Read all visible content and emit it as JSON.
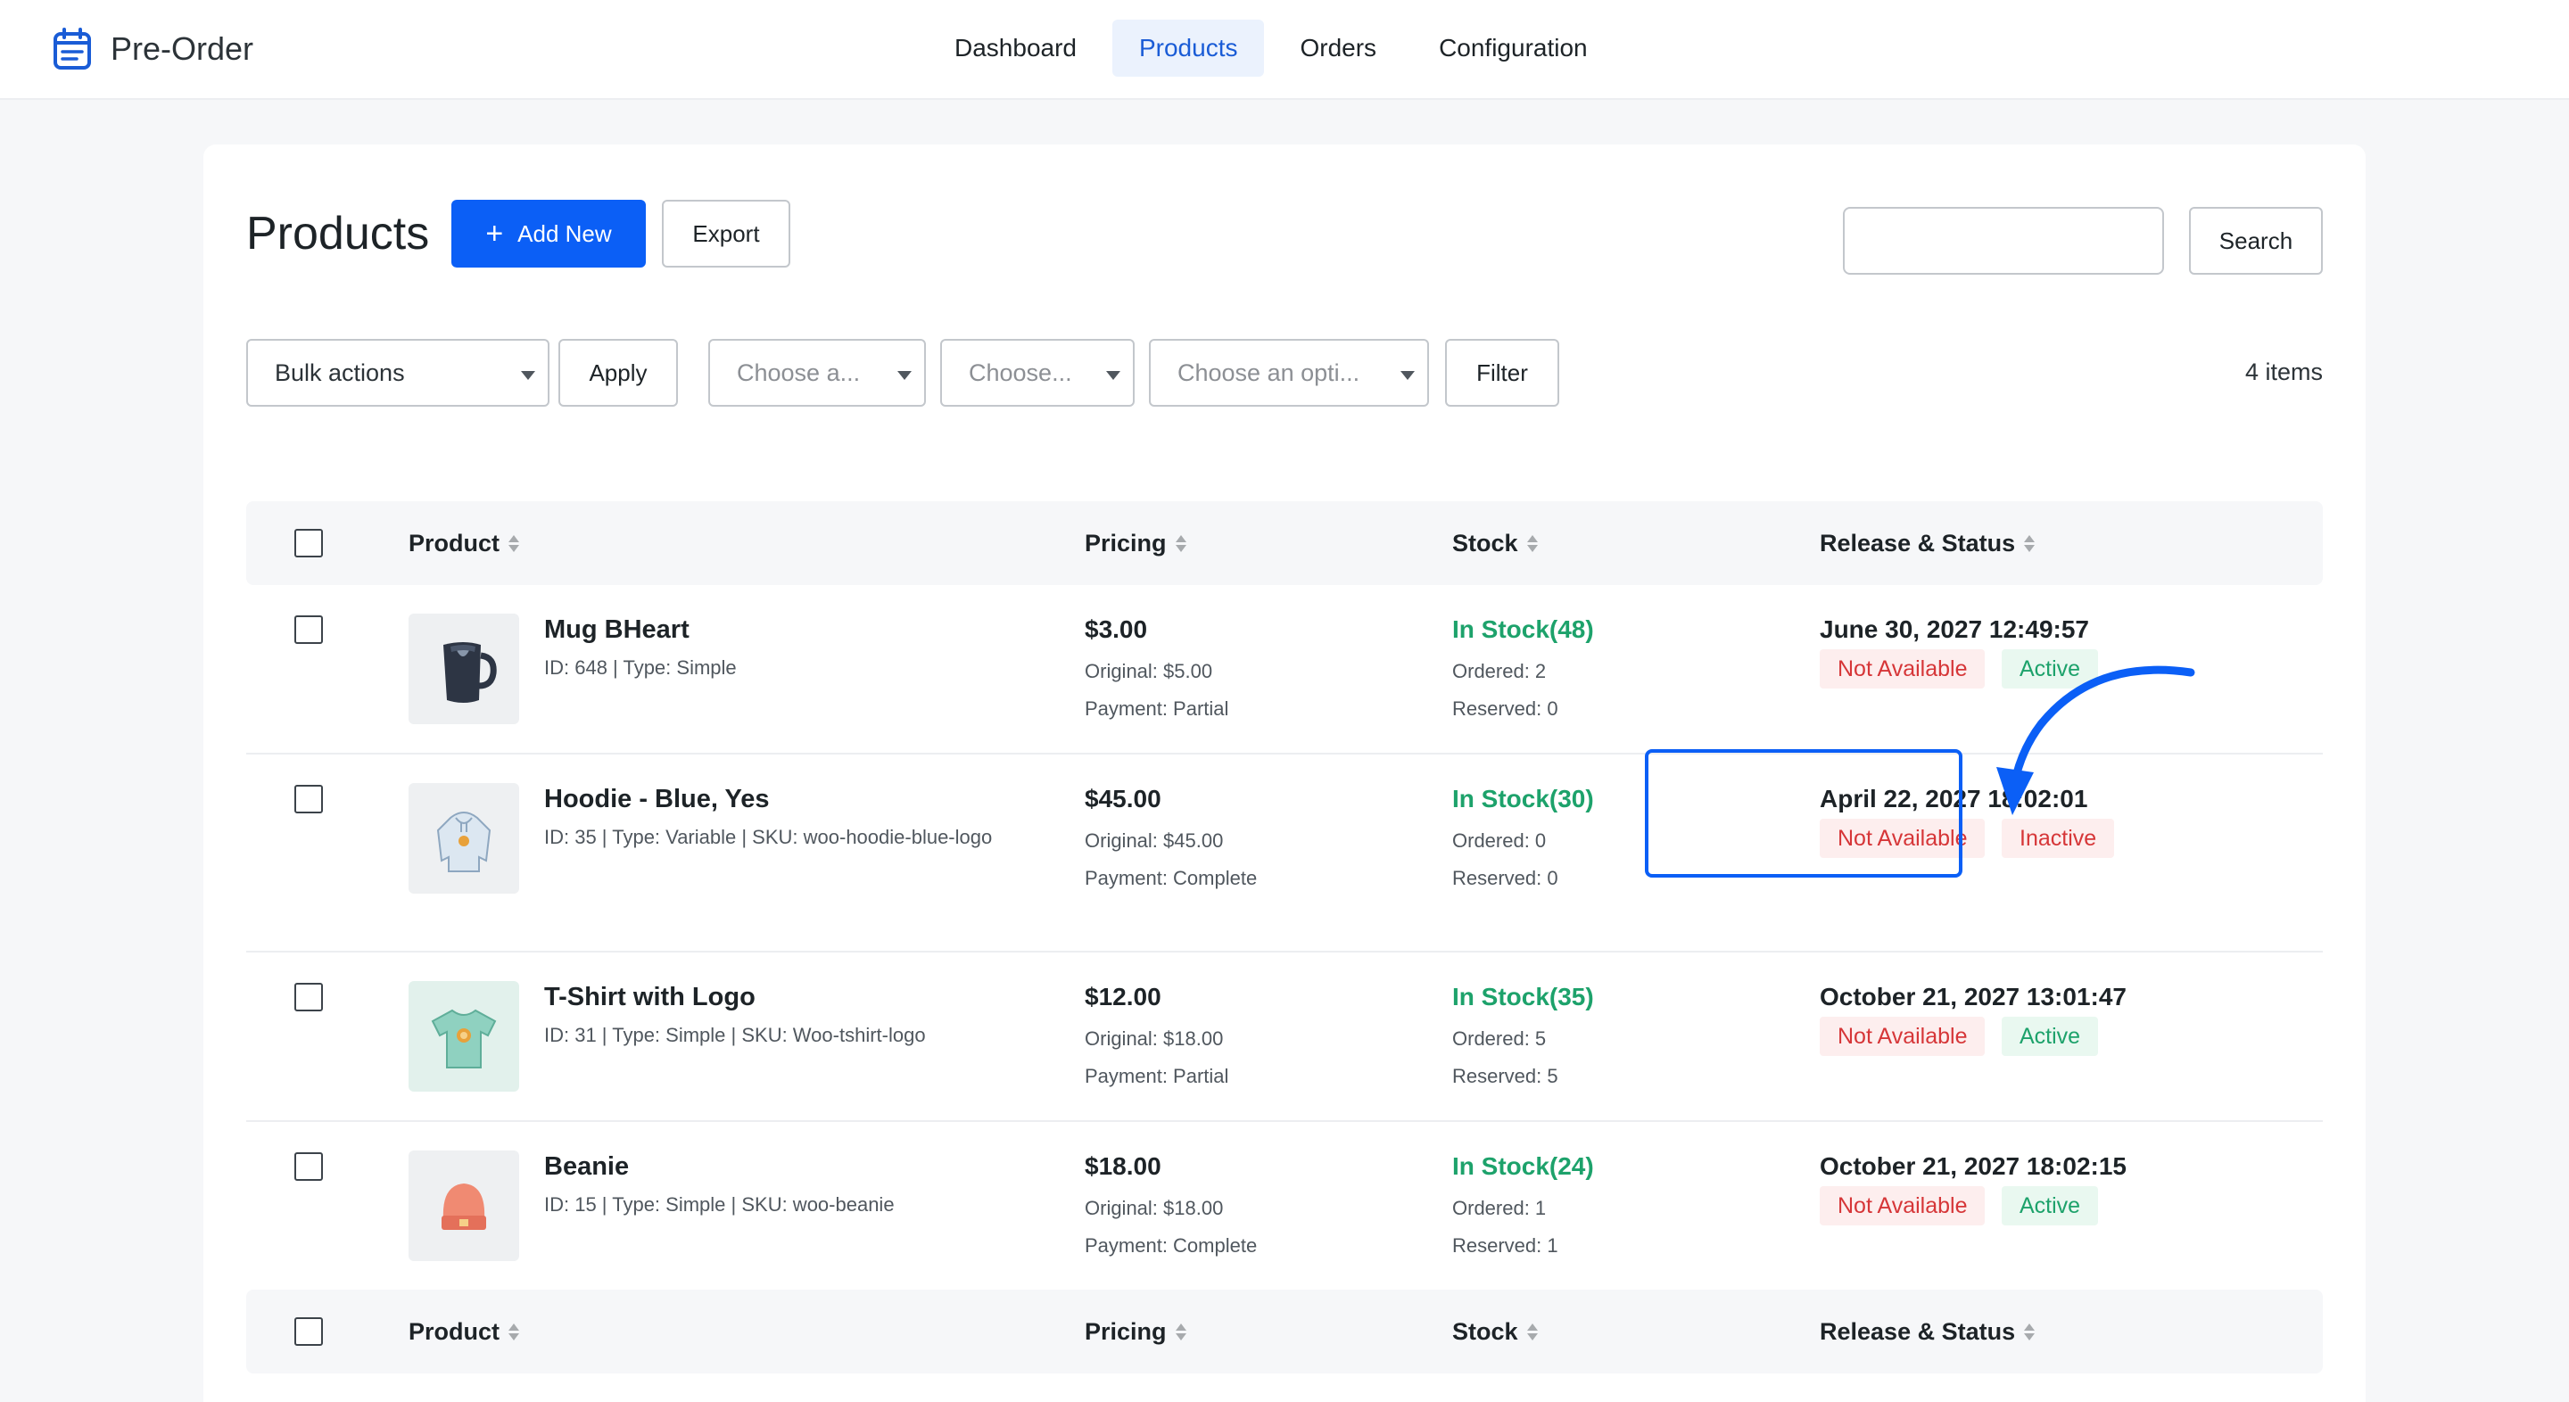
{
  "app": {
    "name": "Pre-Order",
    "icon": "calendar-icon"
  },
  "nav": [
    {
      "label": "Dashboard",
      "active": false
    },
    {
      "label": "Products",
      "active": true
    },
    {
      "label": "Orders",
      "active": false
    },
    {
      "label": "Configuration",
      "active": false
    }
  ],
  "page": {
    "title": "Products",
    "add_new_label": "Add New",
    "export_label": "Export",
    "search_value": "",
    "search_placeholder": "",
    "search_label": "Search"
  },
  "filters": {
    "bulk_actions": "Bulk actions",
    "apply_label": "Apply",
    "select1": "Choose a...",
    "select2": "Choose...",
    "select3": "Choose an opti...",
    "filter_label": "Filter",
    "items_count": "4 items"
  },
  "columns": {
    "product": "Product",
    "pricing": "Pricing",
    "stock": "Stock",
    "release": "Release & Status"
  },
  "products": [
    {
      "name": "Mug BHeart",
      "meta": "ID: 648 | Type: Simple",
      "price": "$3.00",
      "original": "Original: $5.00",
      "payment": "Payment: Partial",
      "stock": "In Stock(48)",
      "ordered": "Ordered: 2",
      "reserved": "Reserved: 0",
      "date": "June 30, 2027 12:49:57",
      "availability": "Not Available",
      "status": "Active"
    },
    {
      "name": "Hoodie - Blue, Yes",
      "meta": "ID: 35 | Type: Variable | SKU: woo-hoodie-blue-logo",
      "price": "$45.00",
      "original": "Original: $45.00",
      "payment": "Payment: Complete",
      "stock": "In Stock(30)",
      "ordered": "Ordered: 0",
      "reserved": "Reserved: 0",
      "date": "April 22, 2027 18:02:01",
      "availability": "Not Available",
      "status": "Inactive"
    },
    {
      "name": "T-Shirt with Logo",
      "meta": "ID: 31 | Type: Simple | SKU: Woo-tshirt-logo",
      "price": "$12.00",
      "original": "Original: $18.00",
      "payment": "Payment: Partial",
      "stock": "In Stock(35)",
      "ordered": "Ordered: 5",
      "reserved": "Reserved: 5",
      "date": "October 21, 2027 13:01:47",
      "availability": "Not Available",
      "status": "Active"
    },
    {
      "name": "Beanie",
      "meta": "ID: 15 | Type: Simple | SKU: woo-beanie",
      "price": "$18.00",
      "original": "Original: $18.00",
      "payment": "Payment: Complete",
      "stock": "In Stock(24)",
      "ordered": "Ordered: 1",
      "reserved": "Reserved: 1",
      "date": "October 21, 2027 18:02:15",
      "availability": "Not Available",
      "status": "Active"
    }
  ],
  "colors": {
    "primary": "#0b5ff6",
    "success": "#1da26b",
    "danger": "#d63638",
    "danger_bg": "#fdeeee",
    "success_bg": "#e9f8f0"
  }
}
